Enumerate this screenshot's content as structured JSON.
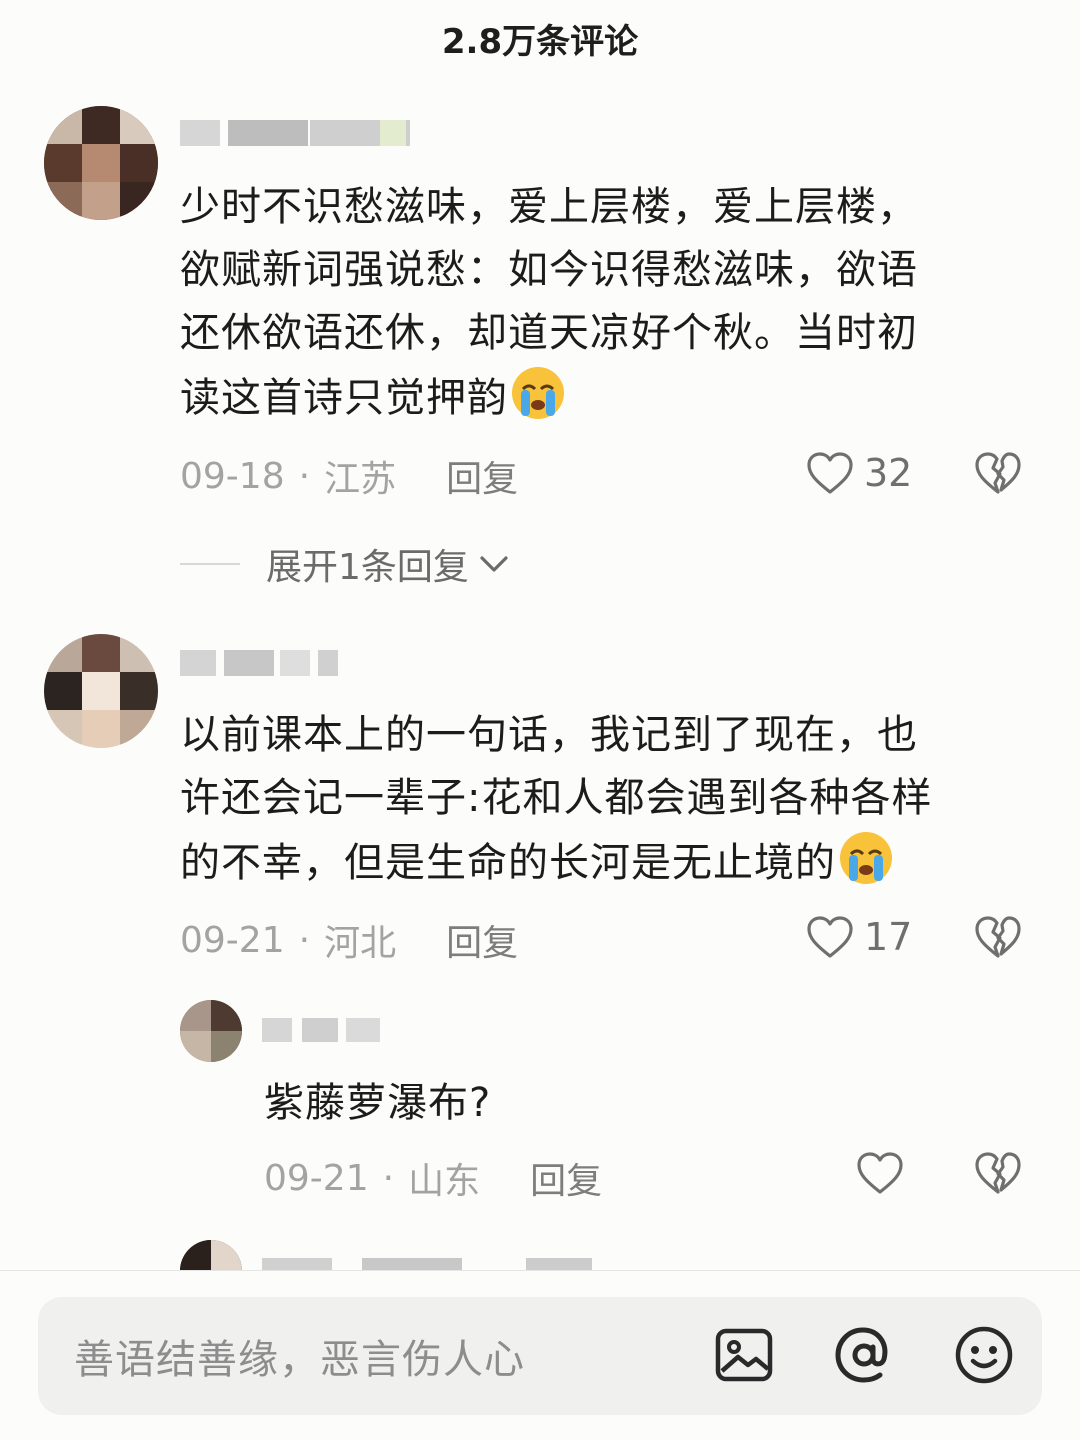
{
  "header": {
    "title": "2.8万条评论"
  },
  "comments": [
    {
      "text_lines": [
        "少时不识愁滋味，爱上层楼，爱上层楼，",
        "欲赋新词强说愁：如今识得愁滋味，欲语",
        "还休欲语还休，却道天凉好个秋。当时初",
        "读这首诗只觉押韵"
      ],
      "emoji": "loudly-crying-face",
      "date": "09-18",
      "separator": "·",
      "location": "江苏",
      "reply_label": "回复",
      "like_count": "32",
      "expand_label": "展开1条回复"
    },
    {
      "text_lines": [
        "以前课本上的一句话，我记到了现在，也",
        "许还会记一辈子:花和人都会遇到各种各样",
        "的不幸，但是生命的长河是无止境的"
      ],
      "emoji": "loudly-crying-face",
      "date": "09-21",
      "separator": "·",
      "location": "河北",
      "reply_label": "回复",
      "like_count": "17"
    }
  ],
  "sub_reply": {
    "text": "紫藤萝瀑布?",
    "date": "09-21",
    "separator": "·",
    "location": "山东",
    "reply_label": "回复",
    "like_count": ""
  },
  "input": {
    "placeholder": "善语结善缘，恶言伤人心"
  },
  "icons": [
    "heart-outline-icon",
    "broken-heart-icon",
    "chevron-down-icon",
    "image-icon",
    "at-mention-icon",
    "smiley-face-icon"
  ],
  "colors": {
    "background": "#fcfcfa",
    "meta_text": "#a3a3a3",
    "input_bg": "#f0f0ef"
  }
}
